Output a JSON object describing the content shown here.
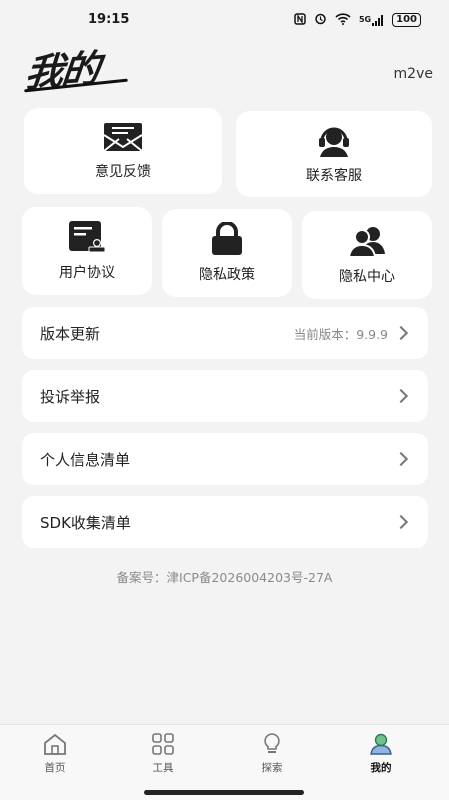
{
  "status_bar": {
    "time": "19:15",
    "signal": "5G",
    "battery": "100"
  },
  "header": {
    "title": "我的",
    "username": "m2ve"
  },
  "cards": {
    "feedback": "意见反馈",
    "customer_service": "联系客服",
    "user_agreement": "用户协议",
    "privacy_policy": "隐私政策",
    "privacy_center": "隐私中心"
  },
  "rows": {
    "version_update": "版本更新",
    "current_version": "当前版本：9.9.9",
    "complaint": "投诉举报",
    "personal_info_list": "个人信息清单",
    "sdk_list": "SDK收集清单"
  },
  "icp": "备案号：津ICP备2026004203号-27A",
  "nav": {
    "home": "首页",
    "tools": "工具",
    "explore": "探索",
    "mine": "我的",
    "active_color": "#4caf50"
  }
}
